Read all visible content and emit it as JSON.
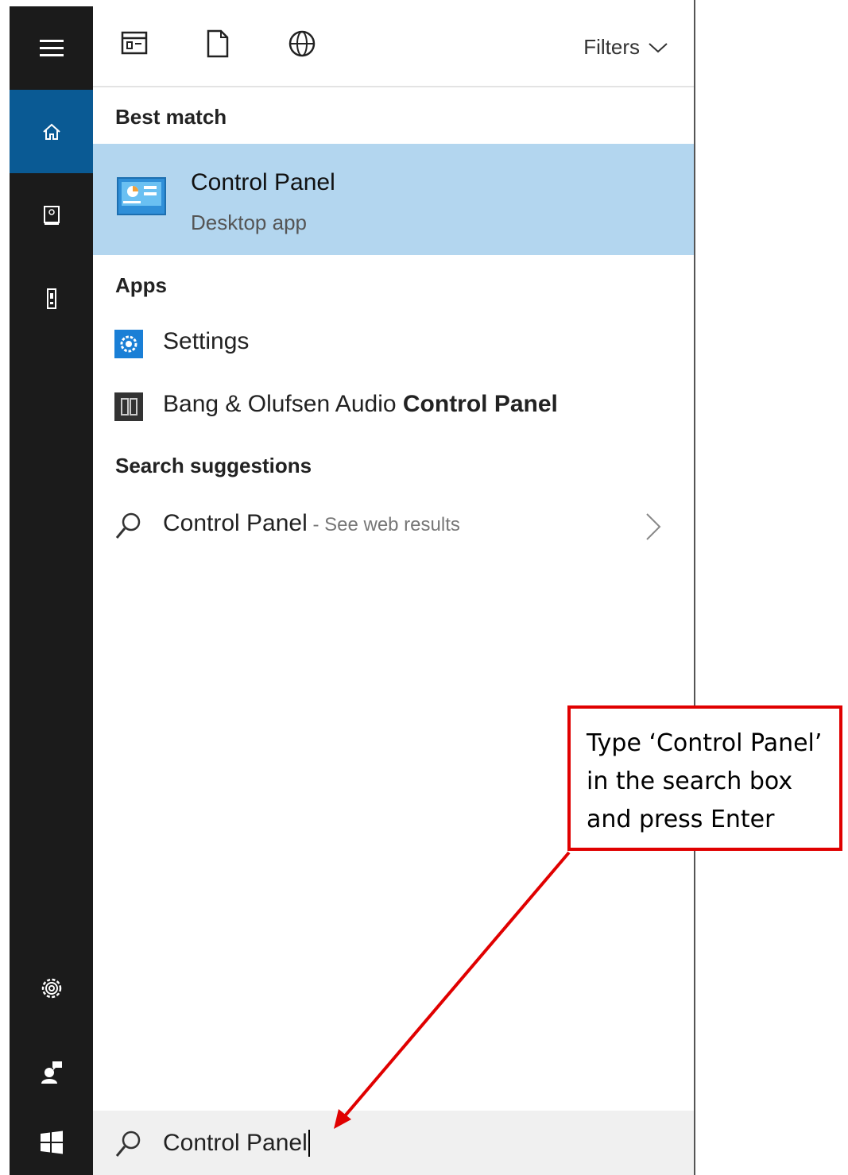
{
  "rail": {
    "items": [
      {
        "name": "hamburger-menu-icon"
      },
      {
        "name": "home-icon",
        "active": true
      },
      {
        "name": "notebook-icon"
      },
      {
        "name": "device-icon"
      }
    ],
    "bottom": [
      {
        "name": "settings-icon"
      },
      {
        "name": "feedback-icon"
      },
      {
        "name": "windows-start-icon"
      }
    ]
  },
  "toolbar": {
    "icons": [
      "apps-filter-icon",
      "documents-filter-icon",
      "web-filter-icon"
    ],
    "filters_label": "Filters"
  },
  "best_match": {
    "heading": "Best match",
    "title": "Control Panel",
    "subtitle": "Desktop app",
    "icon": "control-panel-icon"
  },
  "apps": {
    "heading": "Apps",
    "items": [
      {
        "label": "Settings",
        "icon": "settings-app-icon"
      },
      {
        "label_prefix": "Bang & Olufsen Audio ",
        "label_bold": "Control Panel",
        "icon": "bang-olufsen-icon"
      }
    ]
  },
  "suggestions": {
    "heading": "Search suggestions",
    "items": [
      {
        "label": "Control Panel",
        "suffix": " - See web results",
        "icon": "search-icon"
      }
    ]
  },
  "search": {
    "value": "Control Panel"
  },
  "callout": {
    "text": "Type ‘Control Panel’ in the search box and press Enter"
  },
  "colors": {
    "rail_bg": "#1b1b1b",
    "active_bg": "#0a5a94",
    "highlight_bg": "#b3d6ef",
    "callout_border": "#e00000"
  }
}
